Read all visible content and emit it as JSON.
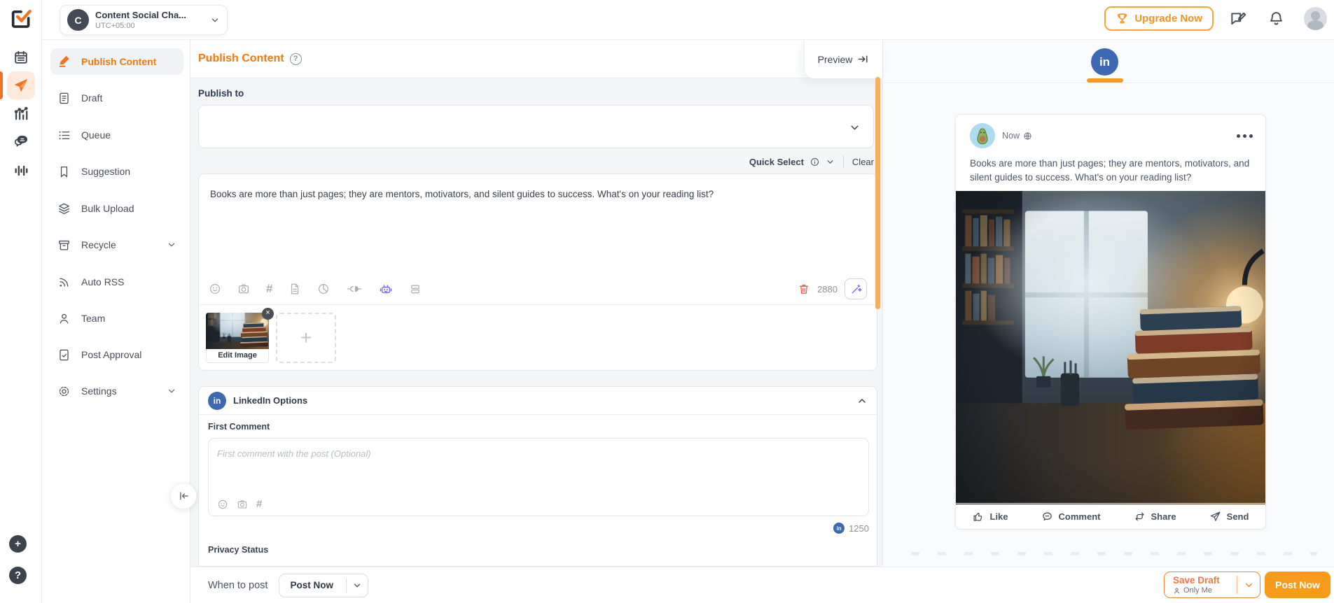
{
  "glyphs": {
    "hashtag": "#",
    "plus": "+",
    "close": "×",
    "question_mark": "?",
    "in_logo": "in"
  },
  "topbar": {
    "workspace": {
      "initial": "C",
      "name": "Content Social Cha...",
      "timezone": "UTC+05:00"
    },
    "upgrade_label": "Upgrade Now"
  },
  "sidebar": {
    "items": [
      {
        "label": "Publish Content"
      },
      {
        "label": "Draft"
      },
      {
        "label": "Queue"
      },
      {
        "label": "Suggestion"
      },
      {
        "label": "Bulk Upload"
      },
      {
        "label": "Recycle"
      },
      {
        "label": "Auto RSS"
      },
      {
        "label": "Team"
      },
      {
        "label": "Post Approval"
      },
      {
        "label": "Settings"
      }
    ]
  },
  "main": {
    "title": "Publish Content",
    "preview_button": "Preview",
    "publish_to_label": "Publish to",
    "quick_select_label": "Quick Select",
    "clear_label": "Clear",
    "composer": {
      "text": "Books are more than just pages; they are mentors, motivators, and silent guides to success. What's on your reading list?",
      "char_count": "2880"
    },
    "media": {
      "edit_image_label": "Edit Image"
    },
    "linkedin_options": {
      "title": "LinkedIn Options",
      "first_comment_label": "First Comment",
      "first_comment_placeholder": "First comment with the post (Optional)",
      "char_count": "1250",
      "privacy_status_label": "Privacy Status"
    }
  },
  "footer": {
    "when_to_post_label": "When to post",
    "schedule_value": "Post Now",
    "save_draft_label": "Save Draft",
    "save_draft_sub": "Only Me",
    "post_now_label": "Post Now"
  },
  "preview": {
    "time_label": "Now",
    "post_text": "Books are more than just pages; they are mentors, motivators, and silent guides to success. What's on your reading list?",
    "actions": [
      "Like",
      "Comment",
      "Share",
      "Send"
    ]
  },
  "colors": {
    "accent_orange": "#f2790f",
    "button_orange": "#f89b1b",
    "linkedin_blue": "#3d69b2",
    "ai_purple": "#7a68e8",
    "danger_red": "#e5554a"
  }
}
